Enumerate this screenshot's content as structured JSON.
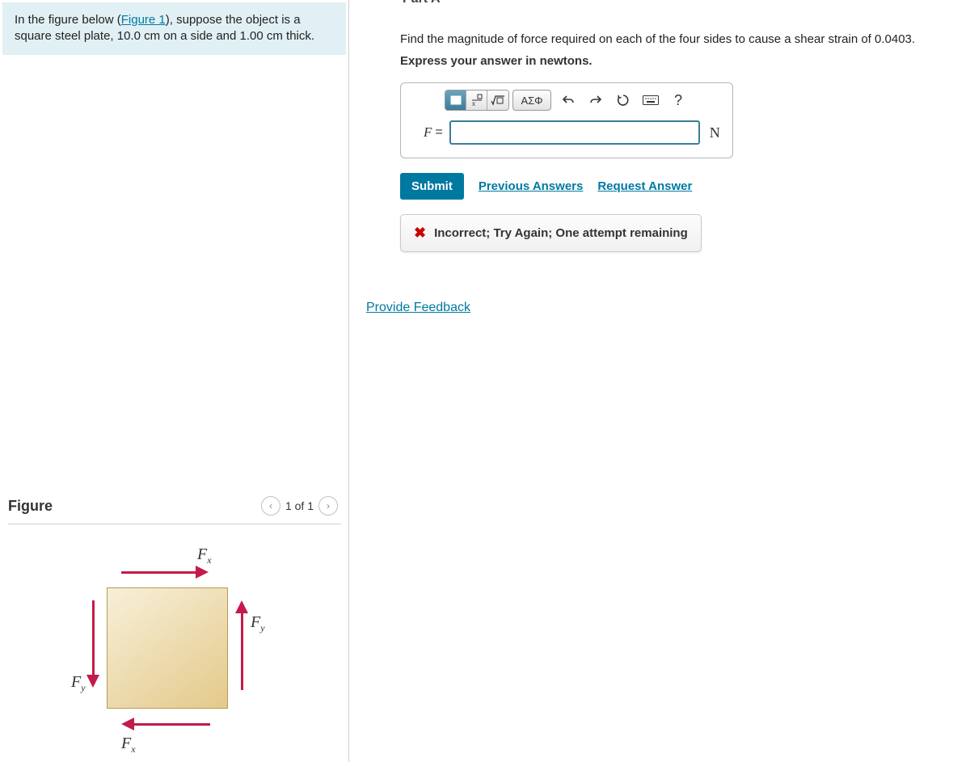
{
  "problem": {
    "intro_before_link": "In the figure below (",
    "figure_link": "Figure 1",
    "intro_after_link": "), suppose the object is a square steel plate, 10.0 cm on a side and 1.00 cm thick."
  },
  "part": {
    "label": "Part A",
    "question": "Find the magnitude of force required on each of the four sides to cause a shear strain of 0.0403.",
    "express": "Express your answer in newtons.",
    "var_label": "F",
    "equals": "=",
    "unit": "N",
    "toolbar": {
      "greek": "ΑΣΦ",
      "help": "?"
    },
    "answer_value": ""
  },
  "actions": {
    "submit": "Submit",
    "previous": "Previous Answers",
    "request": "Request Answer"
  },
  "feedback": {
    "message": "Incorrect; Try Again; One attempt remaining"
  },
  "provide_feedback": "Provide Feedback",
  "figure": {
    "title": "Figure",
    "page": "1 of 1",
    "labels": {
      "fx_top": "F",
      "fx_top_sub": "x",
      "fx_bottom": "F",
      "fx_bottom_sub": "x",
      "fy_left": "F",
      "fy_left_sub": "y",
      "fy_right": "F",
      "fy_right_sub": "y"
    }
  }
}
